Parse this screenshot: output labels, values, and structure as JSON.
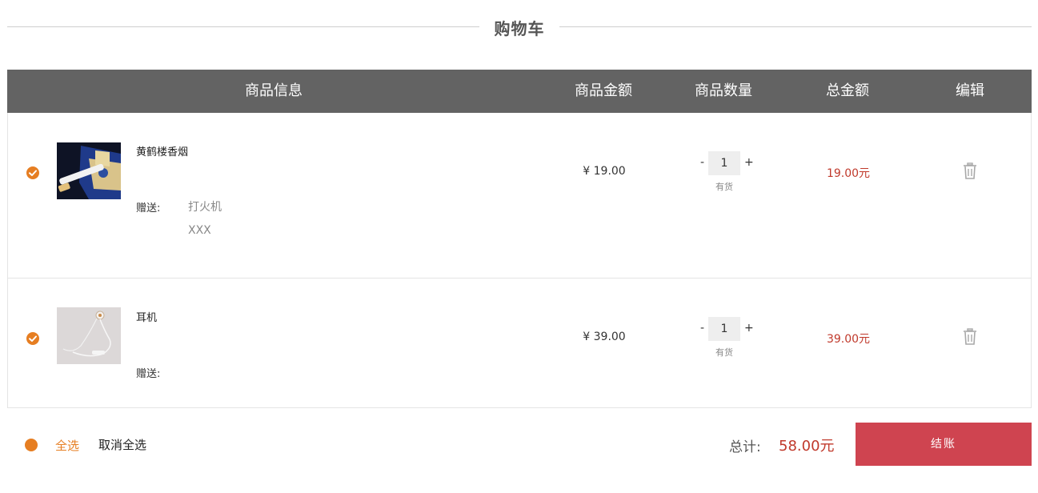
{
  "page": {
    "title": "购物车"
  },
  "table": {
    "headers": {
      "info": "商品信息",
      "price": "商品金额",
      "quantity": "商品数量",
      "total": "总金额",
      "edit": "编辑"
    },
    "items": [
      {
        "name": "黄鹤楼香烟",
        "gift_label": "赠送:",
        "gifts": [
          "打火机",
          "XXX"
        ],
        "price": "¥ 19.00",
        "quantity": "1",
        "minus": "-",
        "plus": "+",
        "stock": "有货",
        "total": "19.00元",
        "checked": true
      },
      {
        "name": "耳机",
        "gift_label": "赠送:",
        "gifts": [],
        "price": "¥ 39.00",
        "quantity": "1",
        "minus": "-",
        "plus": "+",
        "stock": "有货",
        "total": "39.00元",
        "checked": true
      }
    ]
  },
  "footer": {
    "select_all": "全选",
    "unselect_all": "取消全选",
    "sum_label": "总计:",
    "sum_value": "58.00元",
    "checkout": "结账"
  },
  "colors": {
    "accent": "#e67e22",
    "header_bg": "#636363",
    "price_red": "#c0392b",
    "checkout_bg": "#cf4450"
  },
  "icons": {
    "check": "check-circle-icon",
    "delete": "trash-icon"
  }
}
